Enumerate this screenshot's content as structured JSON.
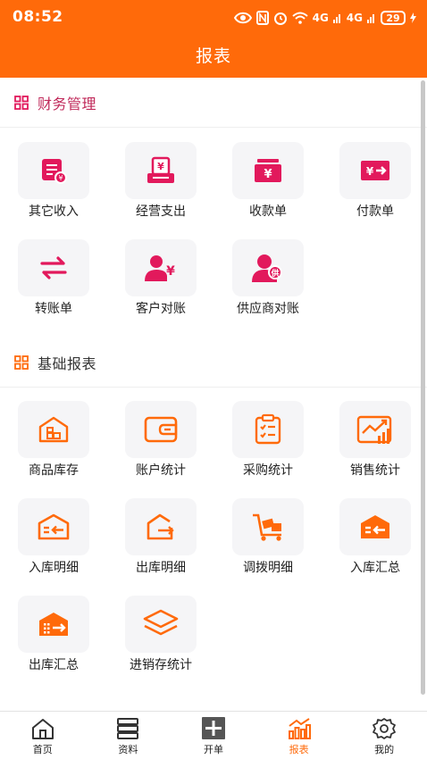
{
  "status": {
    "time": "08:52",
    "net1": "4G",
    "net2": "4G",
    "battery": "29"
  },
  "header": {
    "title": "报表"
  },
  "finance": {
    "title": "财务管理",
    "items": [
      {
        "label": "其它收入",
        "icon": "other-income-icon"
      },
      {
        "label": "经营支出",
        "icon": "operating-expense-icon"
      },
      {
        "label": "收款单",
        "icon": "receipt-icon"
      },
      {
        "label": "付款单",
        "icon": "payment-icon"
      },
      {
        "label": "转账单",
        "icon": "transfer-icon"
      },
      {
        "label": "客户对账",
        "icon": "customer-reconcile-icon"
      },
      {
        "label": "供应商对账",
        "icon": "supplier-reconcile-icon"
      }
    ]
  },
  "basic": {
    "title": "基础报表",
    "items": [
      {
        "label": "商品库存",
        "icon": "warehouse-icon"
      },
      {
        "label": "账户统计",
        "icon": "wallet-icon"
      },
      {
        "label": "采购统计",
        "icon": "clipboard-icon"
      },
      {
        "label": "销售统计",
        "icon": "sales-chart-icon"
      },
      {
        "label": "入库明细",
        "icon": "stock-in-detail-icon"
      },
      {
        "label": "出库明细",
        "icon": "stock-out-detail-icon"
      },
      {
        "label": "调拨明细",
        "icon": "trolley-icon"
      },
      {
        "label": "入库汇总",
        "icon": "stock-in-summary-icon"
      },
      {
        "label": "出库汇总",
        "icon": "stock-out-summary-icon"
      },
      {
        "label": "进销存统计",
        "icon": "layers-icon"
      }
    ]
  },
  "nav": [
    {
      "label": "首页",
      "icon": "home-icon"
    },
    {
      "label": "资料",
      "icon": "server-icon"
    },
    {
      "label": "开单",
      "icon": "plus-icon"
    },
    {
      "label": "报表",
      "icon": "bar-chart-icon",
      "active": true
    },
    {
      "label": "我的",
      "icon": "settings-icon"
    }
  ],
  "colors": {
    "brand": "#ff6a0a",
    "finance": "#e2195c",
    "basic": "#ff6a0a"
  }
}
